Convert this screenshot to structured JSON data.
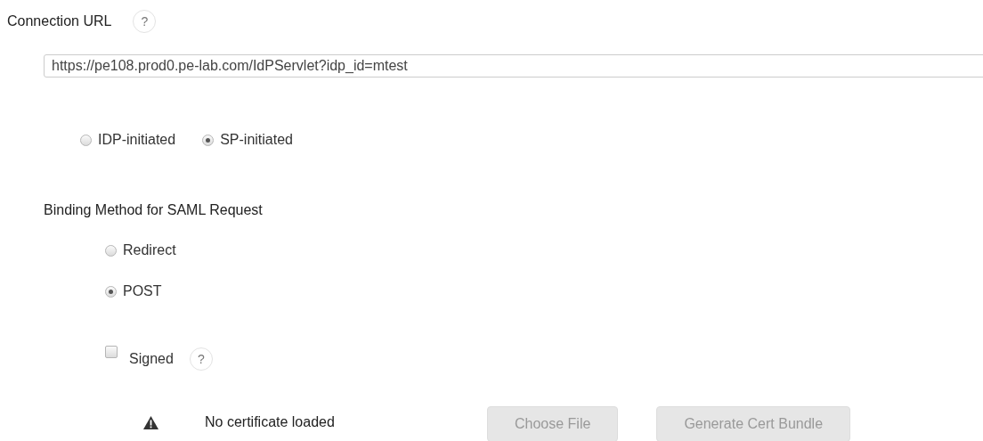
{
  "connection_url": {
    "label": "Connection URL",
    "help": "?",
    "value": "https://pe108.prod0.pe-lab.com/IdPServlet?idp_id=mtest"
  },
  "initiation": [
    {
      "label": "IDP-initiated",
      "selected": false
    },
    {
      "label": "SP-initiated",
      "selected": true
    }
  ],
  "binding": {
    "label": "Binding Method for SAML Request",
    "options": [
      {
        "label": "Redirect",
        "selected": false
      },
      {
        "label": "POST",
        "selected": true
      }
    ]
  },
  "signed": {
    "label": "Signed",
    "checked": false,
    "help": "?"
  },
  "certificate": {
    "status": "No certificate loaded",
    "buttons": [
      {
        "label": "Choose File",
        "disabled": true
      },
      {
        "label": "Generate Cert Bundle",
        "disabled": true
      }
    ]
  }
}
